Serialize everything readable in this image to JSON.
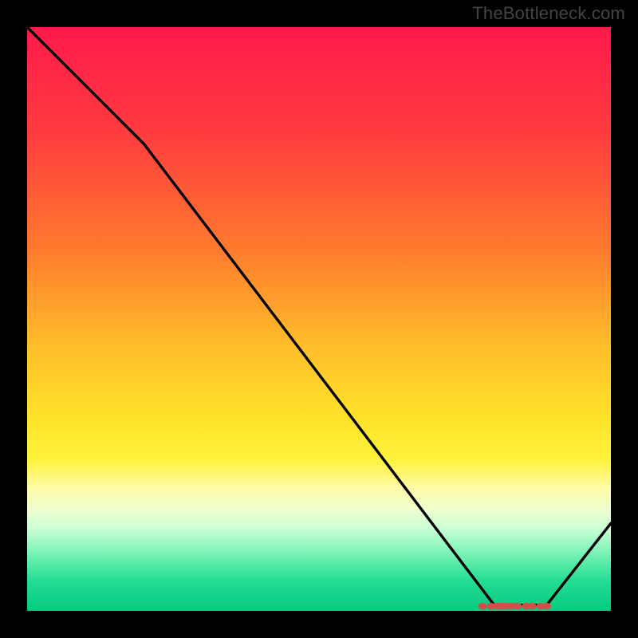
{
  "watermark": "TheBottleneck.com",
  "colors": {
    "frame": "#000000",
    "watermark": "#444444",
    "curve": "#000000",
    "marker": "#d94a4a",
    "gradient_top": "#ff1a4b",
    "gradient_bottom": "#07c97e"
  },
  "chart_data": {
    "type": "line",
    "title": "",
    "xlabel": "",
    "ylabel": "",
    "xlim": [
      0,
      100
    ],
    "ylim": [
      0,
      100
    ],
    "series": [
      {
        "name": "curve",
        "x": [
          0,
          20,
          80,
          89,
          100
        ],
        "y": [
          100,
          80,
          1,
          1,
          15
        ]
      }
    ],
    "markers": {
      "name": "highlight",
      "y": 0.8,
      "x_values": [
        78,
        79.5,
        80.5,
        81.2,
        82,
        83,
        84,
        85.5,
        86.5,
        88,
        89
      ]
    },
    "grid": false,
    "legend_position": "none"
  }
}
